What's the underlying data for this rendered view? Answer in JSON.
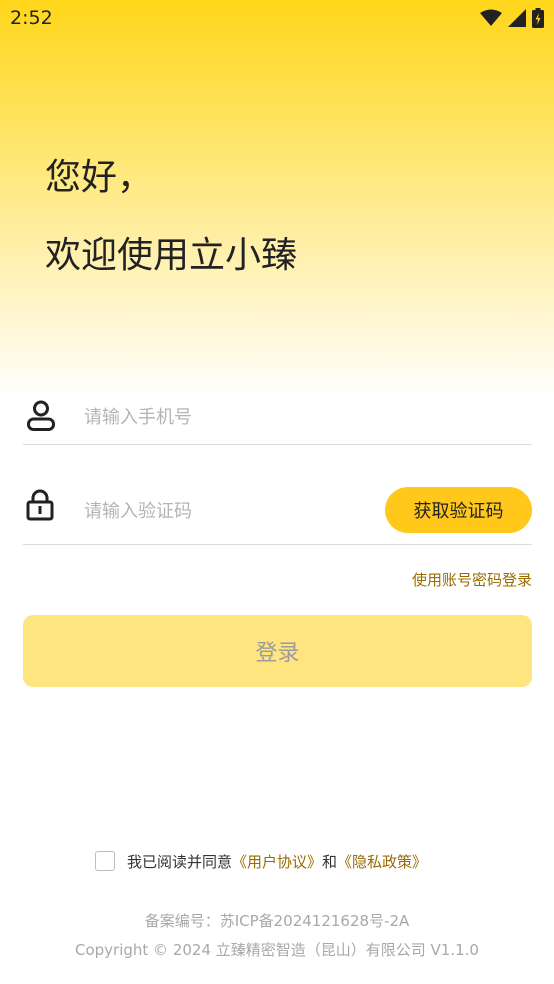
{
  "status_bar": {
    "time": "2:52"
  },
  "greeting": {
    "line1": "您好，",
    "line2": "欢迎使用立小臻"
  },
  "phone": {
    "placeholder": "请输入手机号"
  },
  "code": {
    "placeholder": "请输入验证码",
    "get_code_label": "获取验证码"
  },
  "account_login_link": "使用账号密码登录",
  "login_button": "登录",
  "agreement": {
    "prefix": "我已阅读并同意",
    "user_agreement": "《用户协议》",
    "and": "和",
    "privacy_policy": "《隐私政策》"
  },
  "footer": {
    "icp": "备案编号：苏ICP备2024121628号-2A",
    "copyright": "Copyright © 2024 立臻精密智造（昆山）有限公司 V1.1.0"
  },
  "colors": {
    "accent": "#ffc81a",
    "login_disabled": "#ffe580",
    "link": "#9a6b00"
  }
}
